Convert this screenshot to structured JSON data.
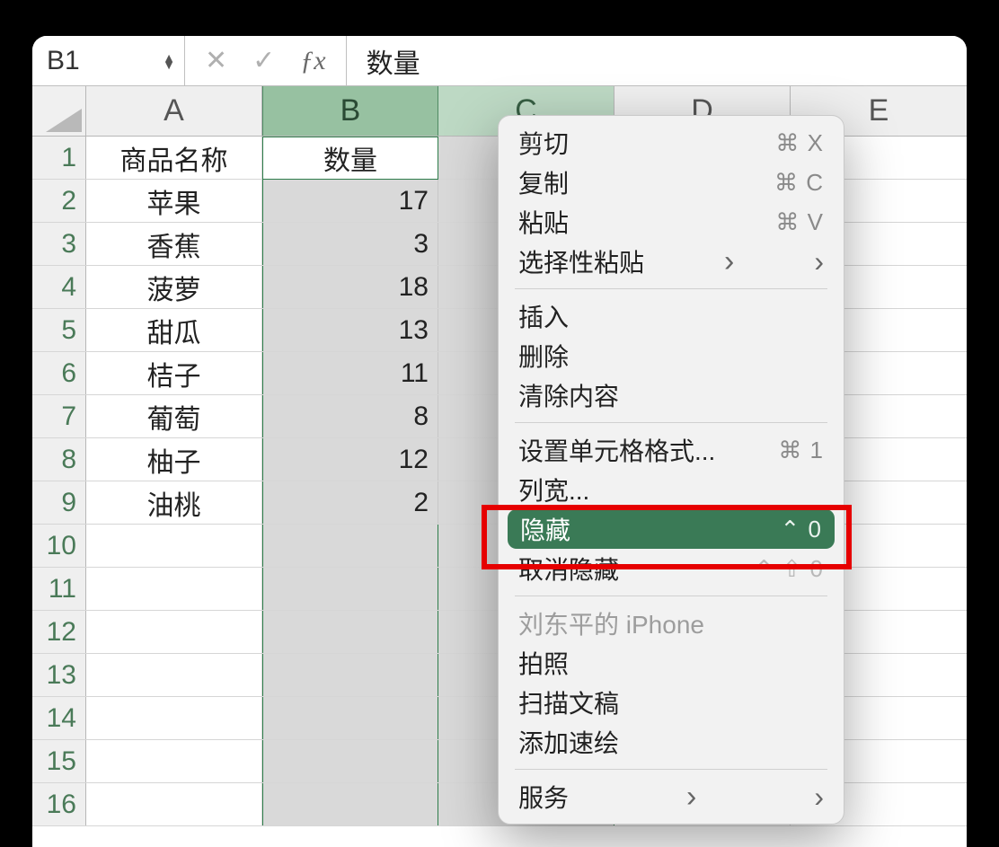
{
  "formula_bar": {
    "name_box": "B1",
    "value": "数量"
  },
  "columns": [
    "A",
    "B",
    "C",
    "D",
    "E"
  ],
  "row_count": 16,
  "headers": {
    "A": "商品名称",
    "B": "数量"
  },
  "data": [
    {
      "name": "苹果",
      "qty": "17"
    },
    {
      "name": "香蕉",
      "qty": "3"
    },
    {
      "name": "菠萝",
      "qty": "18"
    },
    {
      "name": "甜瓜",
      "qty": "13"
    },
    {
      "name": "桔子",
      "qty": "11"
    },
    {
      "name": "葡萄",
      "qty": "8"
    },
    {
      "name": "柚子",
      "qty": "12"
    },
    {
      "name": "油桃",
      "qty": "2"
    }
  ],
  "menu": {
    "cut": {
      "label": "剪切",
      "shortcut": "⌘ X"
    },
    "copy": {
      "label": "复制",
      "shortcut": "⌘ C"
    },
    "paste": {
      "label": "粘贴",
      "shortcut": "⌘ V"
    },
    "paste_special": {
      "label": "选择性粘贴"
    },
    "insert": {
      "label": "插入"
    },
    "delete": {
      "label": "删除"
    },
    "clear": {
      "label": "清除内容"
    },
    "format": {
      "label": "设置单元格格式...",
      "shortcut": "⌘ 1"
    },
    "colwidth": {
      "label": "列宽..."
    },
    "hide": {
      "label": "隐藏",
      "shortcut": "⌃ 0"
    },
    "unhide": {
      "label": "取消隐藏",
      "shortcut": "⌃ ⇧ 0"
    },
    "iphone": {
      "label": "刘东平的 iPhone"
    },
    "photo": {
      "label": "拍照"
    },
    "scan": {
      "label": "扫描文稿"
    },
    "sketch": {
      "label": "添加速绘"
    },
    "services": {
      "label": "服务"
    }
  }
}
